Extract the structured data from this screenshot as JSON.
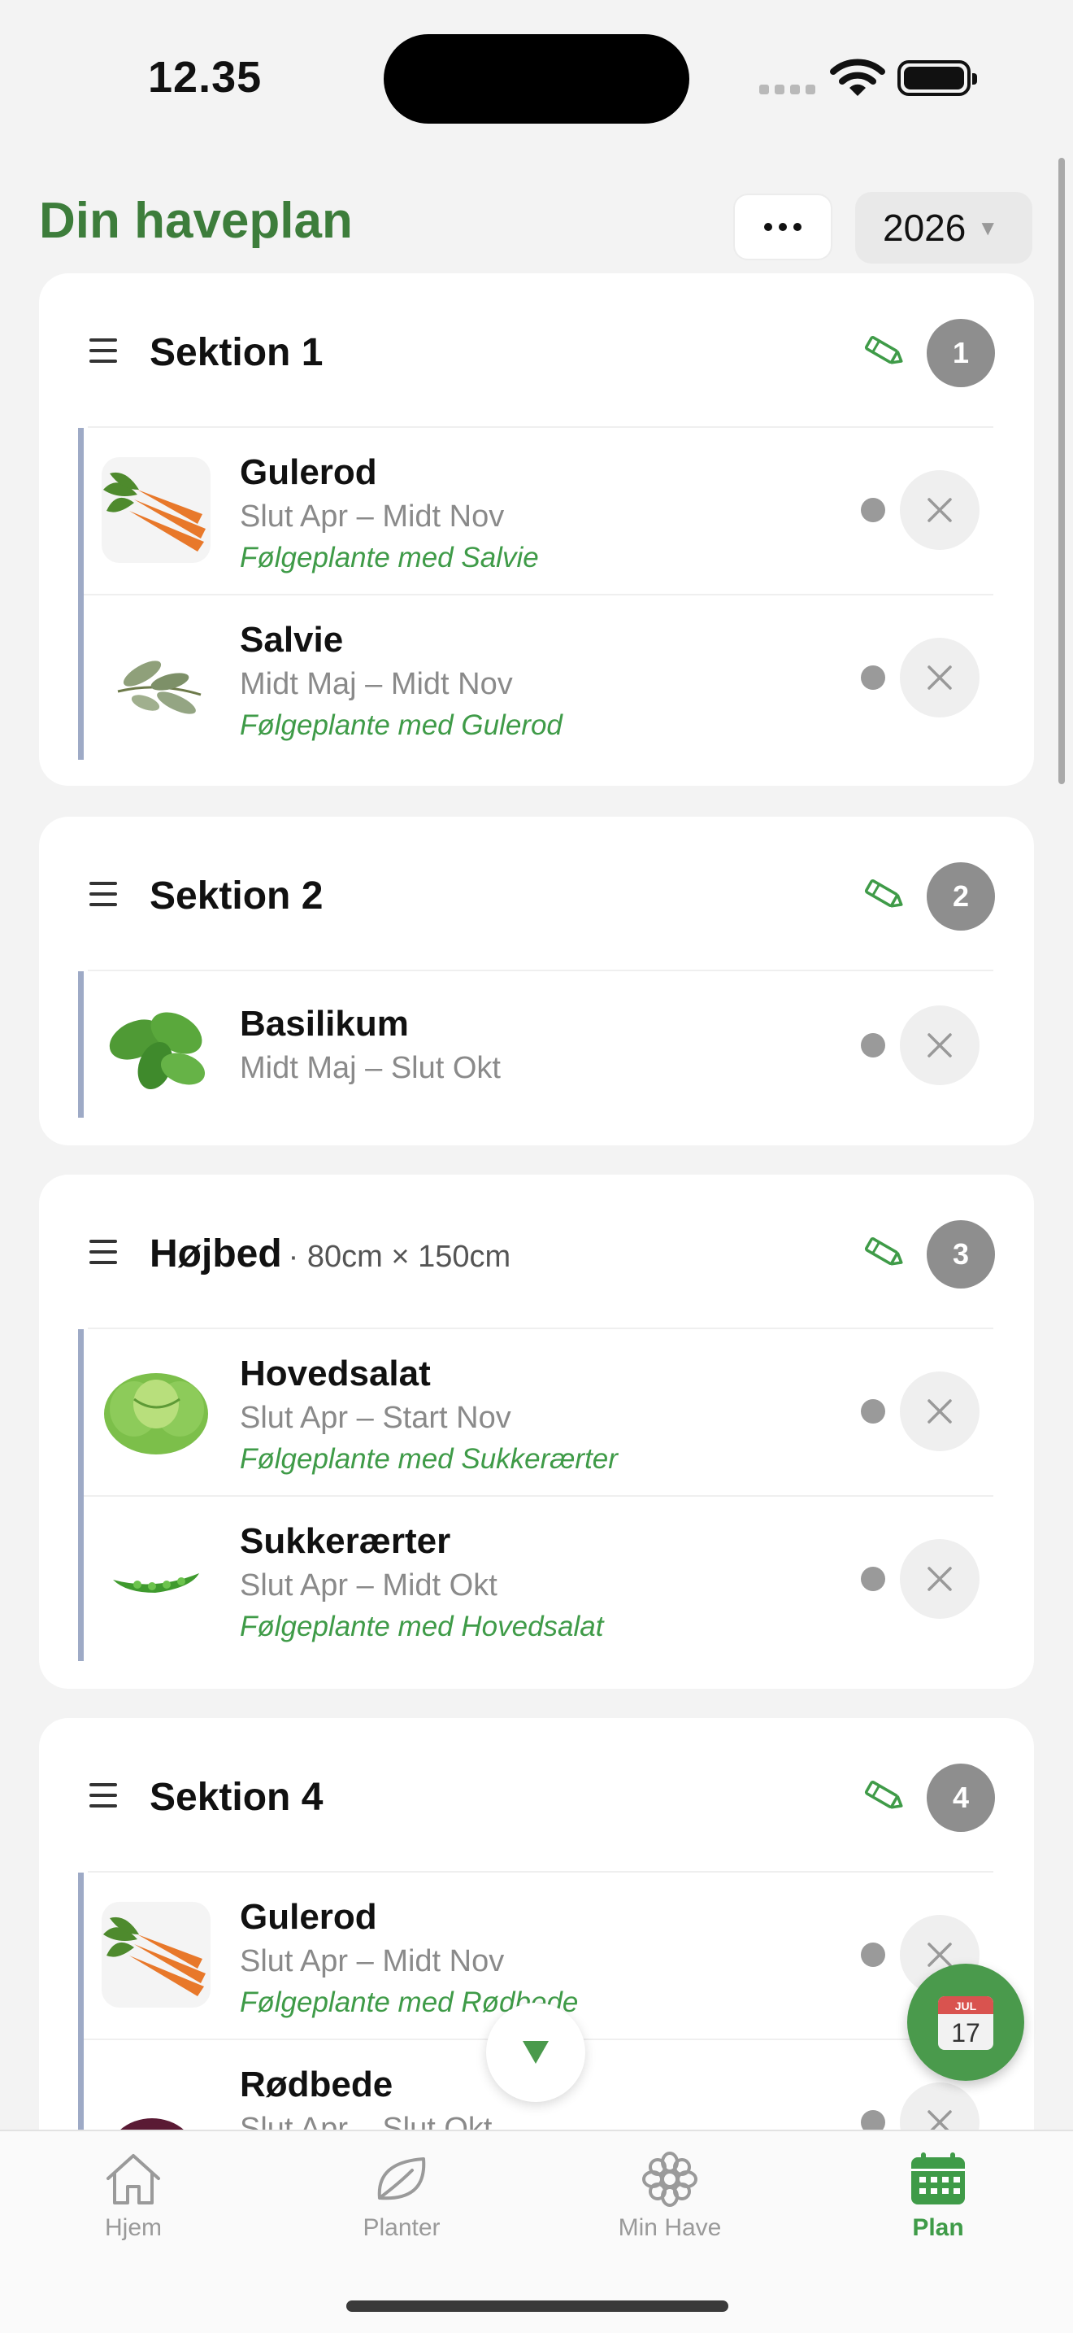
{
  "status_bar": {
    "time": "12.35"
  },
  "header": {
    "title": "Din haveplan",
    "year": "2026"
  },
  "colors": {
    "accent": "#3f9b48",
    "title_green": "#3d7d3b",
    "badge_gray": "#8e8e8e",
    "list_bar": "#9eaac6"
  },
  "sections": [
    {
      "title": "Sektion 1",
      "dims": "",
      "count": "1",
      "plants": [
        {
          "name": "Gulerod",
          "dates": "Slut Apr – Midt Nov",
          "companion": "Følgeplante med Salvie"
        },
        {
          "name": "Salvie",
          "dates": "Midt Maj – Midt Nov",
          "companion": "Følgeplante med Gulerod"
        }
      ]
    },
    {
      "title": "Sektion 2",
      "dims": "",
      "count": "2",
      "plants": [
        {
          "name": "Basilikum",
          "dates": "Midt Maj – Slut Okt",
          "companion": ""
        }
      ]
    },
    {
      "title": "Højbed",
      "dims": "· 80cm × 150cm",
      "count": "3",
      "plants": [
        {
          "name": "Hovedsalat",
          "dates": "Slut Apr – Start Nov",
          "companion": "Følgeplante med Sukkerærter"
        },
        {
          "name": "Sukkerærter",
          "dates": "Slut Apr – Midt Okt",
          "companion": "Følgeplante med Hovedsalat"
        }
      ]
    },
    {
      "title": "Sektion 4",
      "dims": "",
      "count": "4",
      "plants": [
        {
          "name": "Gulerod",
          "dates": "Slut Apr – Midt Nov",
          "companion": "Følgeplante med Rødbede"
        },
        {
          "name": "Rødbede",
          "dates": "Slut Apr – Slut Okt",
          "companion": ""
        }
      ]
    }
  ],
  "fab": {
    "calendar_month": "JUL",
    "calendar_day": "17"
  },
  "tabs": [
    {
      "label": "Hjem",
      "icon": "house-icon"
    },
    {
      "label": "Planter",
      "icon": "leaf-icon"
    },
    {
      "label": "Min Have",
      "icon": "flower-icon"
    },
    {
      "label": "Plan",
      "icon": "calendar-icon",
      "active": true
    }
  ]
}
